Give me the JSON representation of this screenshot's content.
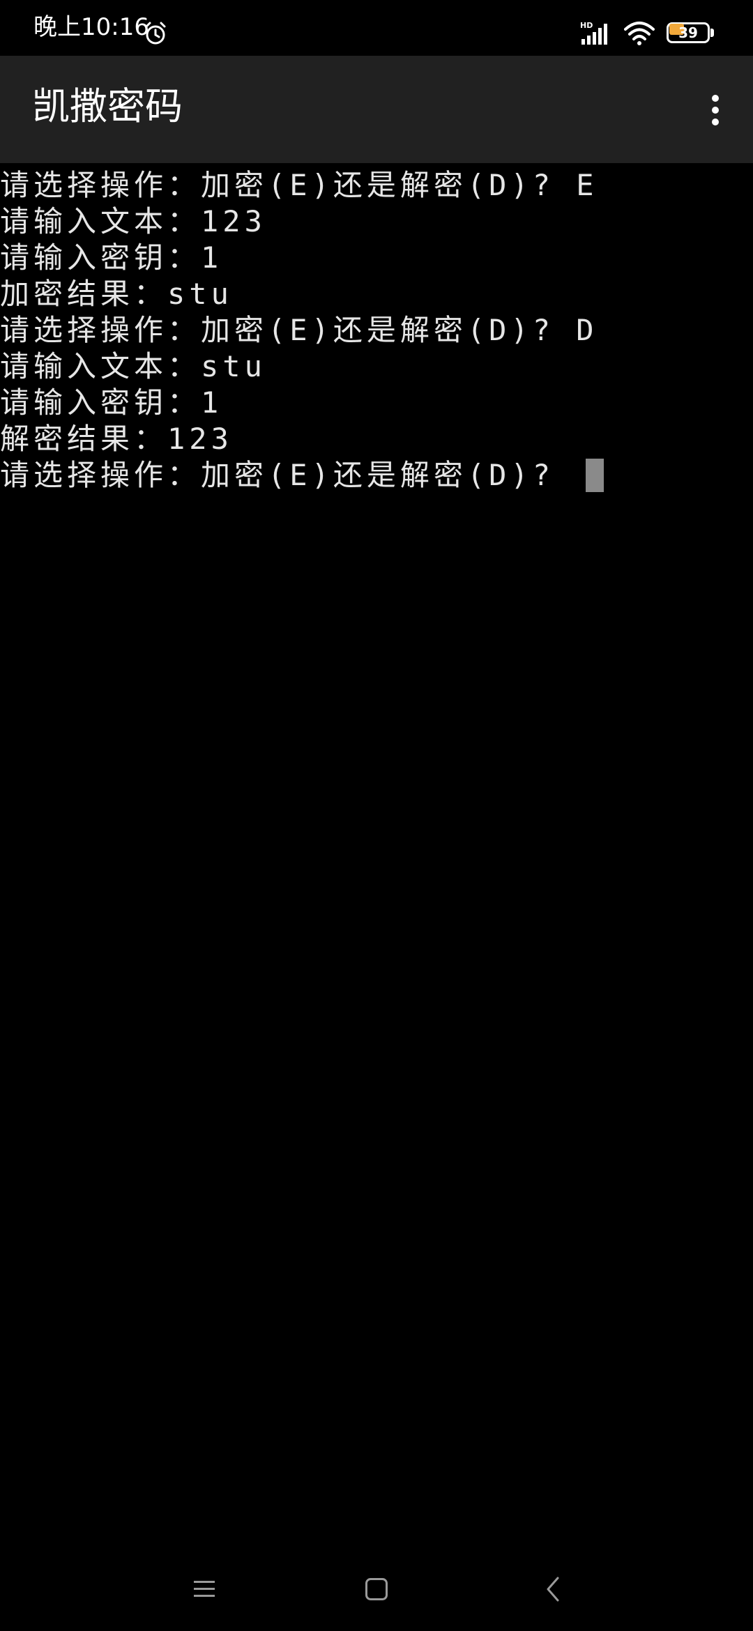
{
  "status_bar": {
    "time": "晚上10:16",
    "network_label": "HD",
    "battery_level": "39",
    "battery_fraction": 0.39,
    "icons": [
      "alarm-icon",
      "signal-icon",
      "wifi-icon",
      "battery-icon"
    ]
  },
  "app_bar": {
    "title": "凯撒密码",
    "overflow_icon": "more-vert-icon"
  },
  "console": {
    "lines": [
      "请选择操作：加密(E)还是解密(D)? E",
      "请输入文本：123",
      "请输入密钥：1",
      "加密结果：stu",
      "请选择操作：加密(E)还是解密(D)? D",
      "请输入文本：stu",
      "请输入密钥：1",
      "解密结果：123",
      "请选择操作：加密(E)还是解密(D)? "
    ]
  },
  "nav_bar": {
    "icons": [
      "recent-apps-icon",
      "home-icon",
      "back-icon"
    ]
  },
  "colors": {
    "background": "#000000",
    "app_bar": "#212121",
    "console_text": "#e6e6e6",
    "cursor": "#8a8a8a",
    "battery_fill": "#f2a93b"
  }
}
